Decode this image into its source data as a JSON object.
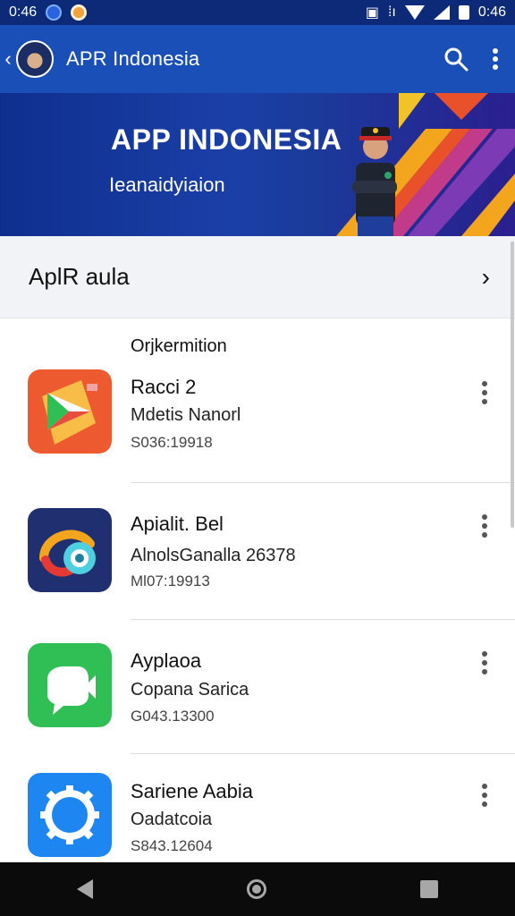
{
  "status_bar": {
    "time": "0:46",
    "clock_right": "0:46"
  },
  "app_bar": {
    "title": "APR Indonesia"
  },
  "banner": {
    "title": "APP INDONESIA",
    "subtitle": "Ieanaidyiaion"
  },
  "section": {
    "title": "AplR aula"
  },
  "list": {
    "caption": "Orjkermition",
    "items": [
      {
        "name": "Racci 2",
        "desc": "Mdetis Nanorl",
        "meta": "S036:19918",
        "icon": "play-store-icon",
        "color": "#ee5a2f"
      },
      {
        "name": "Apialit. Bel",
        "desc": "AlnolsGanalla 26378",
        "meta": "Ml07:19913",
        "icon": "eye-swirl-icon",
        "color": "#1f2f6f"
      },
      {
        "name": "Ayplaoa",
        "desc": "Copana Sarica",
        "meta": "G043.13300",
        "icon": "video-camera-icon",
        "color": "#2fbf55"
      },
      {
        "name": "Sariene Aabia",
        "desc": "Oadatcoia",
        "meta": "S843.12604",
        "icon": "gear-icon",
        "color": "#1e86f0"
      }
    ]
  },
  "colors": {
    "status_bar": "#0d2a78",
    "app_bar": "#1b4fb8",
    "banner": "#1a3fa7"
  }
}
